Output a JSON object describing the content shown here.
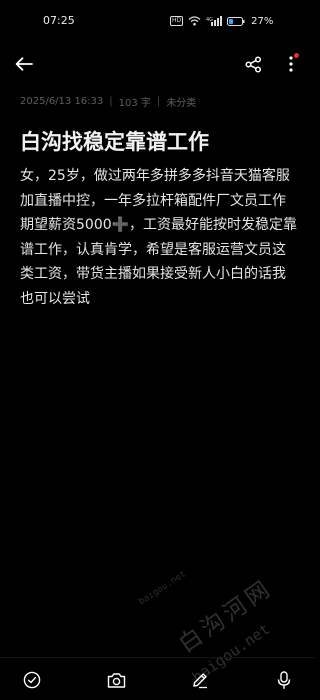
{
  "status_bar": {
    "time": "07:25",
    "hd_label": "HD",
    "signal_label": "4G",
    "battery_percent": "27%",
    "icons": [
      "hd-icon",
      "wifi-icon",
      "signal-icon",
      "battery-icon"
    ]
  },
  "toolbar": {
    "icons": [
      "back-arrow-icon",
      "share-icon",
      "more-vertical-icon"
    ],
    "badge_color": "#e0302c"
  },
  "note": {
    "meta": {
      "date": "2025/6/13 16:33",
      "word_count": "103 字",
      "category": "未分类"
    },
    "title": "白沟找稳定靠谱工作",
    "body": "女，25岁，做过两年多拼多多抖音天猫客服加直播中控，一年多拉杆箱配件厂文员工作期望薪资5000➕，工资最好能按时发稳定靠谱工作，认真肯学，希望是客服运营文员这类工资，带货主播如果接受新人小白的话我也可以尝试"
  },
  "watermark": {
    "small": "baigou.net",
    "big": "白沟河网",
    "url": "baigou.net"
  },
  "bottom_bar": {
    "icons": [
      "checklist-icon",
      "camera-icon",
      "pen-icon",
      "microphone-icon"
    ]
  }
}
